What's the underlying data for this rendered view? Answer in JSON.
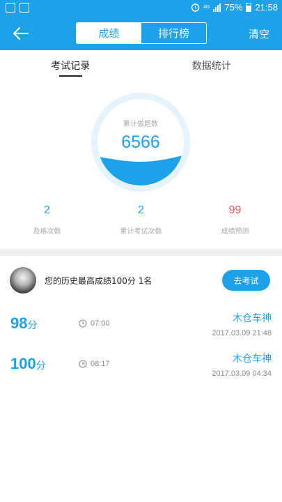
{
  "status_bar": {
    "network": "4G",
    "battery": "75%",
    "time": "21:58",
    "icons": [
      "notification-icon",
      "image-icon",
      "alarm-icon",
      "signal-icon",
      "battery-icon"
    ]
  },
  "header": {
    "tabs": [
      {
        "label": "成绩",
        "active": true
      },
      {
        "label": "排行榜",
        "active": false
      }
    ],
    "clear_label": "清空"
  },
  "subtabs": [
    {
      "label": "考试记录",
      "active": true
    },
    {
      "label": "数据统计",
      "active": false
    }
  ],
  "summary": {
    "total_label": "累计做题数",
    "total_value": "6566"
  },
  "stats": [
    {
      "value": "2",
      "label": "及格次数"
    },
    {
      "value": "2",
      "label": "累计考试次数"
    },
    {
      "value": "99",
      "label": "成绩预测"
    }
  ],
  "best": {
    "text": "您的历史最高成绩100分  1名",
    "button_label": "去考试"
  },
  "records": [
    {
      "score": "98",
      "unit": "分",
      "duration": "07:00",
      "name": "木仓车神",
      "date": "2017.03.09  21:48"
    },
    {
      "score": "100",
      "unit": "分",
      "duration": "08:17",
      "name": "木仓车神",
      "date": "2017.03.09  04:34"
    }
  ],
  "colors": {
    "accent": "#1da1e8",
    "prediction": "#e05a57",
    "muted": "#aaaaaa"
  }
}
